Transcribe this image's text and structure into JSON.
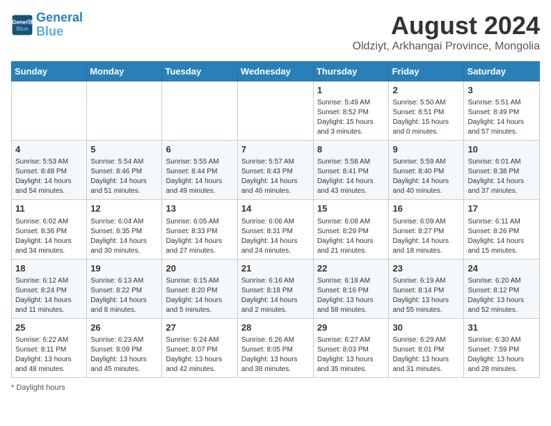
{
  "header": {
    "logo_line1": "General",
    "logo_line2": "Blue",
    "month_title": "August 2024",
    "subtitle": "Oldziyt, Arkhangai Province, Mongolia"
  },
  "days_of_week": [
    "Sunday",
    "Monday",
    "Tuesday",
    "Wednesday",
    "Thursday",
    "Friday",
    "Saturday"
  ],
  "weeks": [
    [
      {
        "day": "",
        "info": ""
      },
      {
        "day": "",
        "info": ""
      },
      {
        "day": "",
        "info": ""
      },
      {
        "day": "",
        "info": ""
      },
      {
        "day": "1",
        "info": "Sunrise: 5:49 AM\nSunset: 8:52 PM\nDaylight: 15 hours\nand 3 minutes."
      },
      {
        "day": "2",
        "info": "Sunrise: 5:50 AM\nSunset: 8:51 PM\nDaylight: 15 hours\nand 0 minutes."
      },
      {
        "day": "3",
        "info": "Sunrise: 5:51 AM\nSunset: 8:49 PM\nDaylight: 14 hours\nand 57 minutes."
      }
    ],
    [
      {
        "day": "4",
        "info": "Sunrise: 5:53 AM\nSunset: 8:48 PM\nDaylight: 14 hours\nand 54 minutes."
      },
      {
        "day": "5",
        "info": "Sunrise: 5:54 AM\nSunset: 8:46 PM\nDaylight: 14 hours\nand 51 minutes."
      },
      {
        "day": "6",
        "info": "Sunrise: 5:55 AM\nSunset: 8:44 PM\nDaylight: 14 hours\nand 49 minutes."
      },
      {
        "day": "7",
        "info": "Sunrise: 5:57 AM\nSunset: 8:43 PM\nDaylight: 14 hours\nand 46 minutes."
      },
      {
        "day": "8",
        "info": "Sunrise: 5:58 AM\nSunset: 8:41 PM\nDaylight: 14 hours\nand 43 minutes."
      },
      {
        "day": "9",
        "info": "Sunrise: 5:59 AM\nSunset: 8:40 PM\nDaylight: 14 hours\nand 40 minutes."
      },
      {
        "day": "10",
        "info": "Sunrise: 6:01 AM\nSunset: 8:38 PM\nDaylight: 14 hours\nand 37 minutes."
      }
    ],
    [
      {
        "day": "11",
        "info": "Sunrise: 6:02 AM\nSunset: 8:36 PM\nDaylight: 14 hours\nand 34 minutes."
      },
      {
        "day": "12",
        "info": "Sunrise: 6:04 AM\nSunset: 8:35 PM\nDaylight: 14 hours\nand 30 minutes."
      },
      {
        "day": "13",
        "info": "Sunrise: 6:05 AM\nSunset: 8:33 PM\nDaylight: 14 hours\nand 27 minutes."
      },
      {
        "day": "14",
        "info": "Sunrise: 6:06 AM\nSunset: 8:31 PM\nDaylight: 14 hours\nand 24 minutes."
      },
      {
        "day": "15",
        "info": "Sunrise: 6:08 AM\nSunset: 8:29 PM\nDaylight: 14 hours\nand 21 minutes."
      },
      {
        "day": "16",
        "info": "Sunrise: 6:09 AM\nSunset: 8:27 PM\nDaylight: 14 hours\nand 18 minutes."
      },
      {
        "day": "17",
        "info": "Sunrise: 6:11 AM\nSunset: 8:26 PM\nDaylight: 14 hours\nand 15 minutes."
      }
    ],
    [
      {
        "day": "18",
        "info": "Sunrise: 6:12 AM\nSunset: 8:24 PM\nDaylight: 14 hours\nand 11 minutes."
      },
      {
        "day": "19",
        "info": "Sunrise: 6:13 AM\nSunset: 8:22 PM\nDaylight: 14 hours\nand 8 minutes."
      },
      {
        "day": "20",
        "info": "Sunrise: 6:15 AM\nSunset: 8:20 PM\nDaylight: 14 hours\nand 5 minutes."
      },
      {
        "day": "21",
        "info": "Sunrise: 6:16 AM\nSunset: 8:18 PM\nDaylight: 14 hours\nand 2 minutes."
      },
      {
        "day": "22",
        "info": "Sunrise: 6:18 AM\nSunset: 8:16 PM\nDaylight: 13 hours\nand 58 minutes."
      },
      {
        "day": "23",
        "info": "Sunrise: 6:19 AM\nSunset: 8:14 PM\nDaylight: 13 hours\nand 55 minutes."
      },
      {
        "day": "24",
        "info": "Sunrise: 6:20 AM\nSunset: 8:12 PM\nDaylight: 13 hours\nand 52 minutes."
      }
    ],
    [
      {
        "day": "25",
        "info": "Sunrise: 6:22 AM\nSunset: 8:11 PM\nDaylight: 13 hours\nand 48 minutes."
      },
      {
        "day": "26",
        "info": "Sunrise: 6:23 AM\nSunset: 8:09 PM\nDaylight: 13 hours\nand 45 minutes."
      },
      {
        "day": "27",
        "info": "Sunrise: 6:24 AM\nSunset: 8:07 PM\nDaylight: 13 hours\nand 42 minutes."
      },
      {
        "day": "28",
        "info": "Sunrise: 6:26 AM\nSunset: 8:05 PM\nDaylight: 13 hours\nand 38 minutes."
      },
      {
        "day": "29",
        "info": "Sunrise: 6:27 AM\nSunset: 8:03 PM\nDaylight: 13 hours\nand 35 minutes."
      },
      {
        "day": "30",
        "info": "Sunrise: 6:29 AM\nSunset: 8:01 PM\nDaylight: 13 hours\nand 31 minutes."
      },
      {
        "day": "31",
        "info": "Sunrise: 6:30 AM\nSunset: 7:59 PM\nDaylight: 13 hours\nand 28 minutes."
      }
    ]
  ],
  "footer": {
    "note": "Daylight hours"
  }
}
